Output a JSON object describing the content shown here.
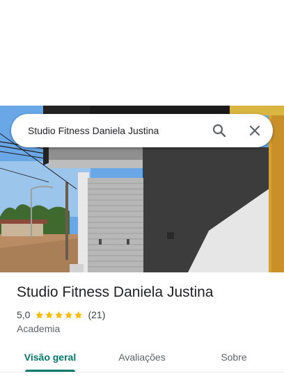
{
  "search": {
    "query": "Studio Fitness Daniela Justina"
  },
  "place": {
    "name": "Studio Fitness Daniela Justina",
    "rating": "5,0",
    "review_count": "(21)",
    "category": "Academia",
    "star_color": "#fbbc04"
  },
  "tabs": [
    {
      "label": "Visão geral",
      "active": true
    },
    {
      "label": "Avaliações",
      "active": false
    },
    {
      "label": "Sobre",
      "active": false
    }
  ],
  "accent_color": "#00796b"
}
